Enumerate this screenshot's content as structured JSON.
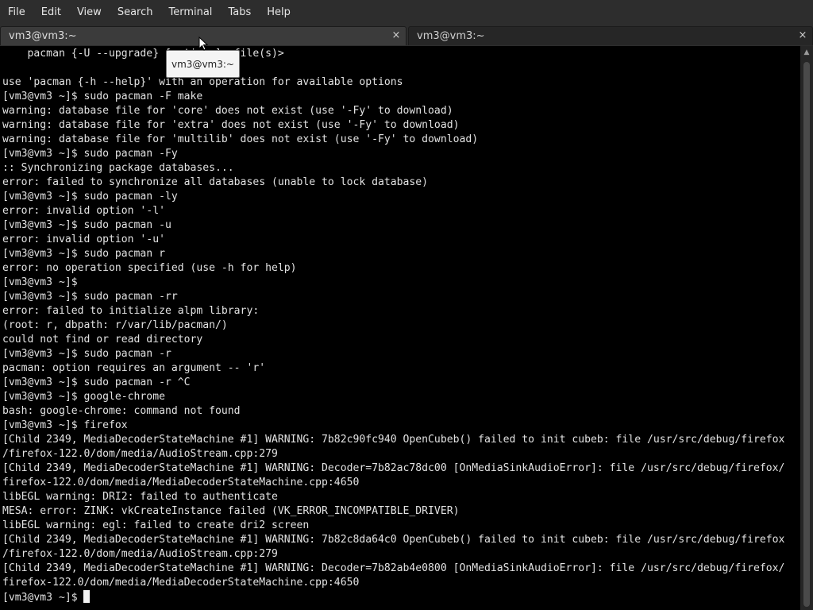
{
  "menubar": {
    "items": [
      "File",
      "Edit",
      "View",
      "Search",
      "Terminal",
      "Tabs",
      "Help"
    ]
  },
  "tabs": [
    {
      "title": "vm3@vm3:~",
      "close_icon": "×",
      "active": true
    },
    {
      "title": "vm3@vm3:~",
      "close_icon": "×",
      "active": false
    }
  ],
  "tooltip": {
    "text": "vm3@vm3:~"
  },
  "terminal": {
    "lines": [
      "    pacman {-U --upgrade} [options] <file(s)>",
      "",
      "use 'pacman {-h --help}' with an operation for available options",
      "[vm3@vm3 ~]$ sudo pacman -F make",
      "warning: database file for 'core' does not exist (use '-Fy' to download)",
      "warning: database file for 'extra' does not exist (use '-Fy' to download)",
      "warning: database file for 'multilib' does not exist (use '-Fy' to download)",
      "[vm3@vm3 ~]$ sudo pacman -Fy",
      ":: Synchronizing package databases...",
      "error: failed to synchronize all databases (unable to lock database)",
      "[vm3@vm3 ~]$ sudo pacman -ly",
      "error: invalid option '-l'",
      "[vm3@vm3 ~]$ sudo pacman -u",
      "error: invalid option '-u'",
      "[vm3@vm3 ~]$ sudo pacman r",
      "error: no operation specified (use -h for help)",
      "[vm3@vm3 ~]$",
      "[vm3@vm3 ~]$ sudo pacman -rr",
      "error: failed to initialize alpm library:",
      "(root: r, dbpath: r/var/lib/pacman/)",
      "could not find or read directory",
      "[vm3@vm3 ~]$ sudo pacman -r",
      "pacman: option requires an argument -- 'r'",
      "[vm3@vm3 ~]$ sudo pacman -r ^C",
      "[vm3@vm3 ~]$ google-chrome",
      "bash: google-chrome: command not found",
      "[vm3@vm3 ~]$ firefox",
      "[Child 2349, MediaDecoderStateMachine #1] WARNING: 7b82c90fc940 OpenCubeb() failed to init cubeb: file /usr/src/debug/firefox",
      "/firefox-122.0/dom/media/AudioStream.cpp:279",
      "[Child 2349, MediaDecoderStateMachine #1] WARNING: Decoder=7b82ac78dc00 [OnMediaSinkAudioError]: file /usr/src/debug/firefox/",
      "firefox-122.0/dom/media/MediaDecoderStateMachine.cpp:4650",
      "libEGL warning: DRI2: failed to authenticate",
      "MESA: error: ZINK: vkCreateInstance failed (VK_ERROR_INCOMPATIBLE_DRIVER)",
      "libEGL warning: egl: failed to create dri2 screen",
      "[Child 2349, MediaDecoderStateMachine #1] WARNING: 7b82c8da64c0 OpenCubeb() failed to init cubeb: file /usr/src/debug/firefox",
      "/firefox-122.0/dom/media/AudioStream.cpp:279",
      "[Child 2349, MediaDecoderStateMachine #1] WARNING: Decoder=7b82ab4e0800 [OnMediaSinkAudioError]: file /usr/src/debug/firefox/",
      "firefox-122.0/dom/media/MediaDecoderStateMachine.cpp:4650"
    ],
    "prompt": "[vm3@vm3 ~]$ "
  },
  "icons": {
    "tab_close": "close-icon",
    "scroll_up": "chevron-up-icon",
    "pointer": "mouse-pointer-icon"
  },
  "colors": {
    "background": "#000000",
    "text": "#e2e2e2",
    "chrome": "#2d2d2d"
  }
}
